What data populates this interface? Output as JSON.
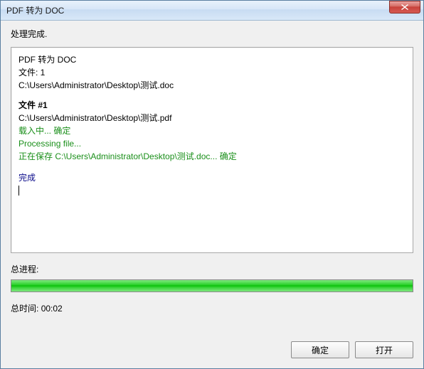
{
  "window": {
    "title": "PDF 转为 DOC"
  },
  "status": "处理完成.",
  "log": {
    "header_title": "PDF 转为 DOC",
    "files_label": "文件: 1",
    "output_path": "C:\\Users\\Administrator\\Desktop\\测试.doc",
    "file_heading": "文件 #1",
    "input_path": "C:\\Users\\Administrator\\Desktop\\测试.pdf",
    "loading_line": "载入中... 确定",
    "processing_line": "Processing file...",
    "saving_line": "正在保存 C:\\Users\\Administrator\\Desktop\\测试.doc... 确定",
    "done_line": "完成"
  },
  "progress": {
    "label": "总进程:",
    "percent": 100
  },
  "time": {
    "label_prefix": "总时间:",
    "value": "00:02"
  },
  "buttons": {
    "ok": "确定",
    "open": "打开"
  }
}
